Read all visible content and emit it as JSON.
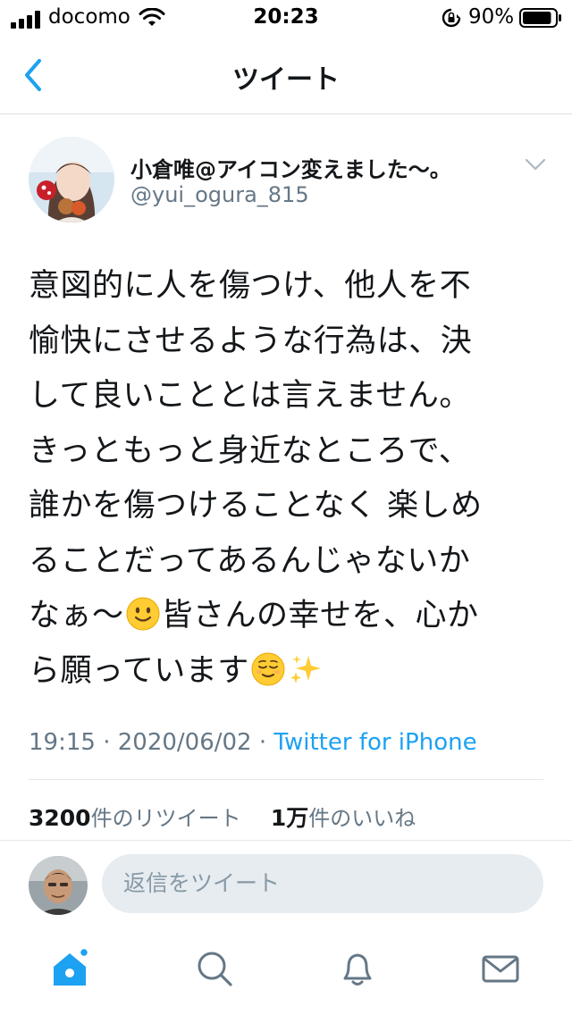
{
  "status_bar": {
    "carrier": "docomo",
    "time": "20:23",
    "battery_percent": "90%",
    "signal_icon": "cellular-signal-icon",
    "wifi_icon": "wifi-icon",
    "rotation_lock_icon": "rotation-lock-icon",
    "battery_icon": "battery-icon",
    "battery_level": 0.9
  },
  "nav": {
    "title": "ツイート",
    "back_icon": "chevron-left-icon",
    "accent_color": "#1da1f2"
  },
  "tweet": {
    "author_name": "小倉唯@アイコン変えました〜。",
    "author_handle": "@yui_ogura_815",
    "text_lines": [
      "意図的に人を傷つけ、他人を不",
      "愉快にさせるような行為は、決",
      "して良いこととは言えません。",
      "きっともっと身近なところで、",
      "誰かを傷つけることなく 楽しめ",
      "ることだってあるんじゃないか",
      "なぁ〜",
      "皆さんの幸せを、心か",
      "ら願っています"
    ],
    "emojis": [
      "slightly-smiling-face",
      "relieved-face",
      "sparkles"
    ],
    "time": "19:15",
    "date": "2020/06/02",
    "separator": "·",
    "source": "Twitter for iPhone"
  },
  "stats": {
    "retweet_count": "3200",
    "retweet_label": "件のリツイート",
    "like_count": "1万",
    "like_label": "件のいいね"
  },
  "reply": {
    "placeholder": "返信をツイート"
  },
  "tabbar": {
    "items": [
      "home-icon",
      "search-icon",
      "notifications-icon",
      "messages-icon"
    ],
    "active_color": "#1da1f2",
    "inactive_color": "#657786"
  }
}
